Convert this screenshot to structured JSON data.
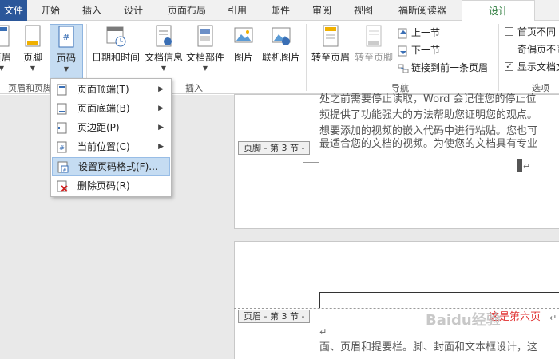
{
  "tabs": [
    {
      "label": "文件"
    },
    {
      "label": "开始"
    },
    {
      "label": "插入"
    },
    {
      "label": "设计"
    },
    {
      "label": "页面布局"
    },
    {
      "label": "引用"
    },
    {
      "label": "邮件"
    },
    {
      "label": "审阅"
    },
    {
      "label": "视图"
    },
    {
      "label": "福昕阅读器"
    },
    {
      "label": "设计"
    }
  ],
  "ribbon": {
    "group_header_footer": "页眉和页脚",
    "group_insert": "插入",
    "group_nav": "导航",
    "group_options": "选项",
    "btn_header": "页眉",
    "btn_footer": "页脚",
    "btn_pagenum": "页码",
    "btn_datetime": "日期和时间",
    "btn_docinfo": "文档信息",
    "btn_docparts": "文档部件",
    "btn_picture": "图片",
    "btn_onlinepic": "联机图片",
    "btn_goto_header": "转至页眉",
    "btn_goto_footer": "转至页脚",
    "btn_prev": "上一节",
    "btn_next": "下一节",
    "btn_link_prev": "链接到前一条页眉",
    "opt_first_page": "首页不同",
    "opt_odd_even": "奇偶页不同",
    "opt_show_text": "显示文档文字"
  },
  "menu": {
    "items": [
      {
        "label": "页面顶端(T)"
      },
      {
        "label": "页面底端(B)"
      },
      {
        "label": "页边距(P)"
      },
      {
        "label": "当前位置(C)"
      },
      {
        "label": "设置页码格式(F)..."
      },
      {
        "label": "删除页码(R)"
      }
    ]
  },
  "doc": {
    "line1": "处之前需要停止读取，Word 会记住您的停止位",
    "line2": "频提供了功能强大的方法帮助您证明您的观点。",
    "line3": "想要添加的视频的嵌入代码中进行粘贴。您也可",
    "line4": "最适合您的文档的视频。为使您的文档具有专业",
    "footer_tag": "页脚 - 第 3 节 -",
    "header_tag": "页眉 - 第 3 节 -",
    "header_text": "这是第六页",
    "line5": "面、页眉和提要栏。脚、封面和文本框设计，这",
    "watermark": "Baidu经验"
  },
  "colors": {
    "file_tab": "#2b579a",
    "design_tab_text": "#2b7a3a",
    "pressed": "#c5dcf2",
    "header_red": "#e03030"
  }
}
